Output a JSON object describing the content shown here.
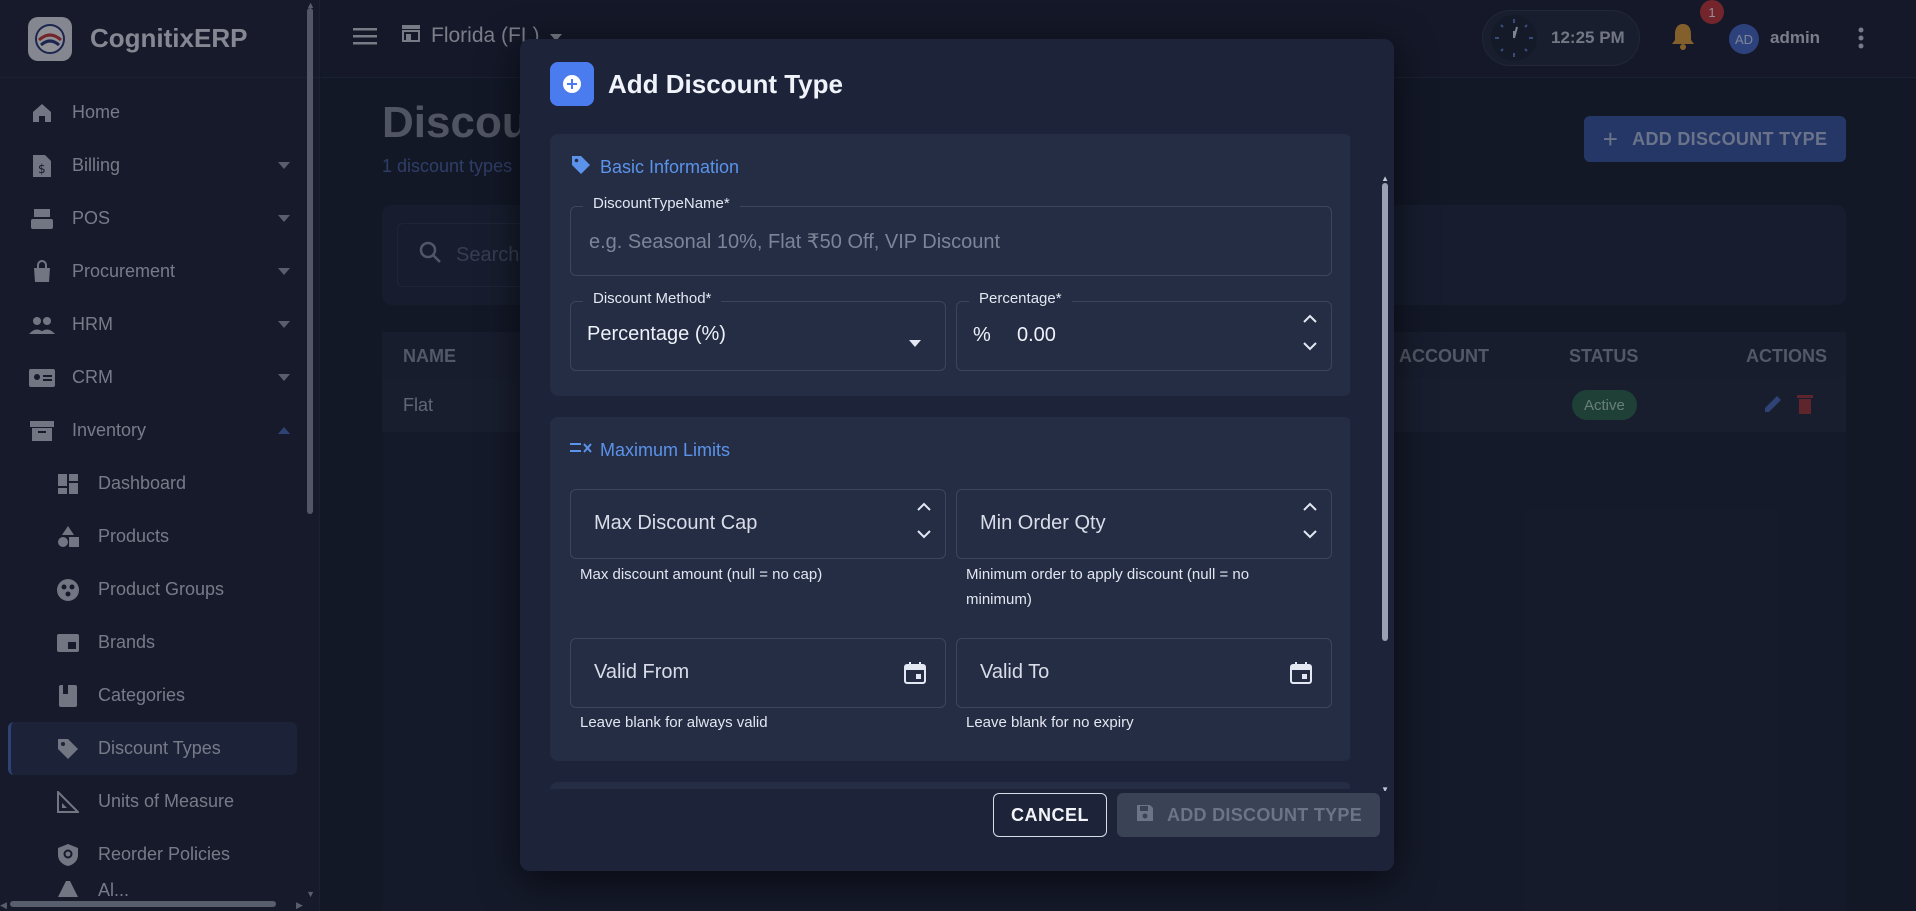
{
  "app": {
    "name": "CognitixERP"
  },
  "sidebar": {
    "items": [
      {
        "label": "Home",
        "icon": "home-icon"
      },
      {
        "label": "Billing",
        "icon": "billing-icon",
        "expandable": true
      },
      {
        "label": "POS",
        "icon": "pos-icon",
        "expandable": true
      },
      {
        "label": "Procurement",
        "icon": "procurement-icon",
        "expandable": true
      },
      {
        "label": "HRM",
        "icon": "people-icon",
        "expandable": true
      },
      {
        "label": "CRM",
        "icon": "contact-card-icon",
        "expandable": true
      },
      {
        "label": "Inventory",
        "icon": "archive-icon",
        "expanded": true
      }
    ],
    "sub_items": [
      {
        "label": "Dashboard",
        "icon": "dashboard-icon"
      },
      {
        "label": "Products",
        "icon": "shapes-icon"
      },
      {
        "label": "Product Groups",
        "icon": "groups-icon"
      },
      {
        "label": "Brands",
        "icon": "brand-icon"
      },
      {
        "label": "Categories",
        "icon": "book-icon"
      },
      {
        "label": "Discount Types",
        "icon": "tag-icon",
        "active": true
      },
      {
        "label": "Units of Measure",
        "icon": "ruler-icon"
      },
      {
        "label": "Reorder Policies",
        "icon": "policy-icon"
      },
      {
        "label": "Al...",
        "icon": "alert-icon"
      }
    ]
  },
  "topbar": {
    "store": "Florida (FL)",
    "time": "12:25 PM",
    "notification_count": "1",
    "user_initials": "AD",
    "user_name": "admin"
  },
  "page": {
    "title": "Discou",
    "subtitle": "1 discount types",
    "add_button": "ADD DISCOUNT TYPE",
    "search_placeholder": "Search",
    "columns": [
      "NAME",
      "ACCOUNT",
      "STATUS",
      "ACTIONS"
    ],
    "rows": [
      {
        "name": "Flat",
        "status": "Active"
      }
    ]
  },
  "modal": {
    "title": "Add Discount Type",
    "basic": {
      "title": "Basic Information",
      "name_label": "DiscountTypeName*",
      "name_placeholder": "e.g. Seasonal 10%, Flat ₹50 Off, VIP Discount",
      "method_label": "Discount Method*",
      "method_value": "Percentage (%)",
      "percentage_label": "Percentage*",
      "percentage_prefix": "%",
      "percentage_value": "0.00"
    },
    "limits": {
      "title": "Maximum Limits",
      "max_cap_label": "Max Discount Cap",
      "max_cap_help": "Max discount amount (null = no cap)",
      "min_qty_label": "Min Order Qty",
      "min_qty_help_1": "Minimum order to apply discount (null = no",
      "min_qty_help_2": "minimum)",
      "valid_from_label": "Valid From",
      "valid_from_help": "Leave blank for always valid",
      "valid_to_label": "Valid To",
      "valid_to_help": "Leave blank for no expiry"
    },
    "cancel": "CANCEL",
    "submit": "ADD DISCOUNT TYPE"
  }
}
